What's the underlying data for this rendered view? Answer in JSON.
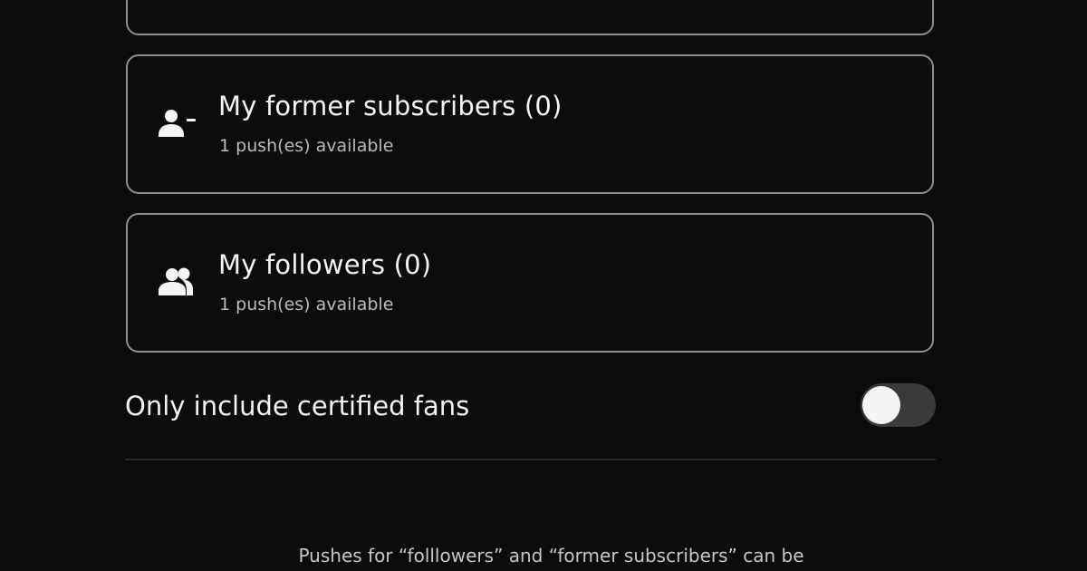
{
  "audiences": [
    {
      "title": "My former subscribers (0)",
      "subtitle": "1 push(es) available",
      "icon": "user-minus-icon"
    },
    {
      "title": "My followers (0)",
      "subtitle": "1 push(es) available",
      "icon": "users-icon"
    }
  ],
  "certified_filter": {
    "label": "Only include certified fans",
    "enabled": false
  },
  "footnote": "Pushes for “folllowers” and “former subscribers” can be",
  "colors": {
    "background": "#0c0c0d",
    "card_border": "#8d8d8f",
    "text_primary": "#f4f4f4",
    "text_secondary": "#b9b9bb",
    "toggle_track_off": "#3a3a3c",
    "toggle_knob": "#f4f4f4"
  }
}
